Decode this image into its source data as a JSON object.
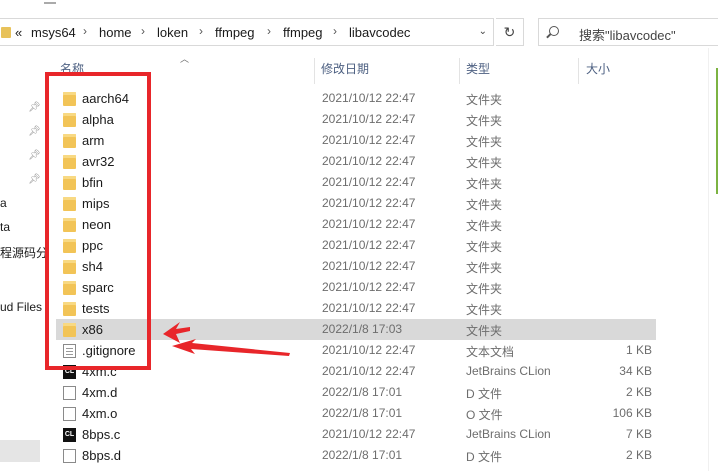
{
  "address": {
    "crumbs": [
      "«",
      "msys64",
      "home",
      "loken",
      "ffmpeg",
      "ffmpeg",
      "libavcodec"
    ],
    "dropdown_icon": "chevron-down-icon"
  },
  "search": {
    "placeholder": "搜索\"libavcodec\""
  },
  "sidebar": {
    "texts": [
      "a",
      "ta",
      "程源码分",
      "ud Files"
    ],
    "pins": 4
  },
  "columns": {
    "name": "名称",
    "date": "修改日期",
    "type": "类型",
    "size": "大小"
  },
  "files": [
    {
      "name": "aarch64",
      "date": "2021/10/12 22:47",
      "type": "文件夹",
      "size": "",
      "icon": "folder-icon"
    },
    {
      "name": "alpha",
      "date": "2021/10/12 22:47",
      "type": "文件夹",
      "size": "",
      "icon": "folder-icon"
    },
    {
      "name": "arm",
      "date": "2021/10/12 22:47",
      "type": "文件夹",
      "size": "",
      "icon": "folder-icon"
    },
    {
      "name": "avr32",
      "date": "2021/10/12 22:47",
      "type": "文件夹",
      "size": "",
      "icon": "folder-icon"
    },
    {
      "name": "bfin",
      "date": "2021/10/12 22:47",
      "type": "文件夹",
      "size": "",
      "icon": "folder-icon"
    },
    {
      "name": "mips",
      "date": "2021/10/12 22:47",
      "type": "文件夹",
      "size": "",
      "icon": "folder-icon"
    },
    {
      "name": "neon",
      "date": "2021/10/12 22:47",
      "type": "文件夹",
      "size": "",
      "icon": "folder-icon"
    },
    {
      "name": "ppc",
      "date": "2021/10/12 22:47",
      "type": "文件夹",
      "size": "",
      "icon": "folder-icon"
    },
    {
      "name": "sh4",
      "date": "2021/10/12 22:47",
      "type": "文件夹",
      "size": "",
      "icon": "folder-icon"
    },
    {
      "name": "sparc",
      "date": "2021/10/12 22:47",
      "type": "文件夹",
      "size": "",
      "icon": "folder-icon"
    },
    {
      "name": "tests",
      "date": "2021/10/12 22:47",
      "type": "文件夹",
      "size": "",
      "icon": "folder-icon"
    },
    {
      "name": "x86",
      "date": "2022/1/8 17:03",
      "type": "文件夹",
      "size": "",
      "icon": "folder-icon",
      "selected": true
    },
    {
      "name": ".gitignore",
      "date": "2021/10/12 22:47",
      "type": "文本文档",
      "size": "1 KB",
      "icon": "text-file-icon"
    },
    {
      "name": "4xm.c",
      "date": "2021/10/12 22:47",
      "type": "JetBrains CLion",
      "size": "34 KB",
      "icon": "clion-file-icon"
    },
    {
      "name": "4xm.d",
      "date": "2022/1/8 17:01",
      "type": "D 文件",
      "size": "2 KB",
      "icon": "file-icon"
    },
    {
      "name": "4xm.o",
      "date": "2022/1/8 17:01",
      "type": "O 文件",
      "size": "106 KB",
      "icon": "file-icon"
    },
    {
      "name": "8bps.c",
      "date": "2021/10/12 22:47",
      "type": "JetBrains CLion",
      "size": "7 KB",
      "icon": "clion-file-icon"
    },
    {
      "name": "8bps.d",
      "date": "2022/1/8 17:01",
      "type": "D 文件",
      "size": "2 KB",
      "icon": "file-icon"
    }
  ],
  "annotation": {
    "box_color": "#e8262a",
    "arrow_color": "#e8262a"
  }
}
